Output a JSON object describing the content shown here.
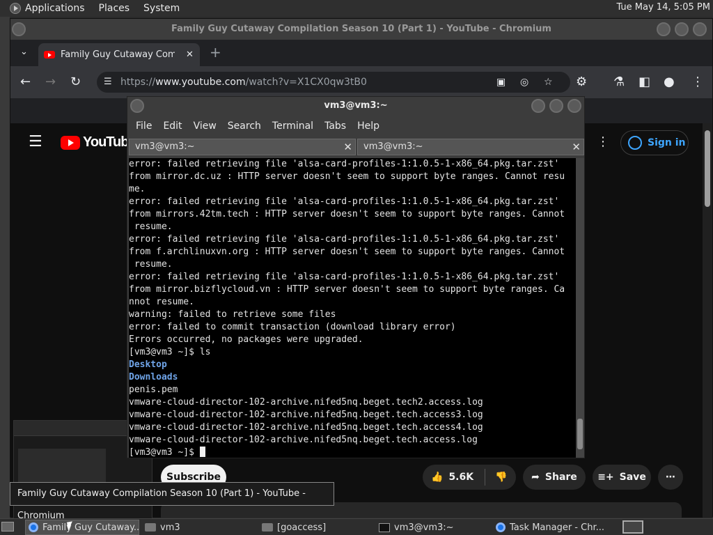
{
  "top_panel": {
    "menus": [
      "Applications",
      "Places",
      "System"
    ],
    "clock": "Tue May 14,  5:05 PM"
  },
  "browser": {
    "window_title": "Family Guy Cutaway Compilation Season 10 (Part 1) - YouTube - Chromium",
    "tab_title": "Family Guy Cutaway Compil",
    "url_prefix": "https://",
    "url_host": "www.youtube.com",
    "url_path": "/watch?v=X1CX0qw3tB0"
  },
  "youtube": {
    "logo_text": "YouTube",
    "sign_in": "Sign in",
    "subscribe": "Subscribe",
    "likes": "5.6K",
    "share": "Share",
    "save": "Save"
  },
  "terminal": {
    "title": "vm3@vm3:~",
    "menu": [
      "File",
      "Edit",
      "View",
      "Search",
      "Terminal",
      "Tabs",
      "Help"
    ],
    "tabs": [
      "vm3@vm3:~",
      "vm3@vm3:~"
    ],
    "lines": [
      "error: failed retrieving file 'alsa-card-profiles-1:1.0.5-1-x86_64.pkg.tar.zst'",
      "from mirror.dc.uz : HTTP server doesn't seem to support byte ranges. Cannot resu",
      "me.",
      "error: failed retrieving file 'alsa-card-profiles-1:1.0.5-1-x86_64.pkg.tar.zst'",
      "from mirrors.42tm.tech : HTTP server doesn't seem to support byte ranges. Cannot",
      " resume.",
      "error: failed retrieving file 'alsa-card-profiles-1:1.0.5-1-x86_64.pkg.tar.zst'",
      "from f.archlinuxvn.org : HTTP server doesn't seem to support byte ranges. Cannot",
      " resume.",
      "error: failed retrieving file 'alsa-card-profiles-1:1.0.5-1-x86_64.pkg.tar.zst'",
      "from mirror.bizflycloud.vn : HTTP server doesn't seem to support byte ranges. Ca",
      "nnot resume.",
      "warning: failed to retrieve some files",
      "error: failed to commit transaction (download library error)",
      "Errors occurred, no packages were upgraded.",
      "[vm3@vm3 ~]$ ls"
    ],
    "ls_dirs": [
      "Desktop",
      "Downloads"
    ],
    "ls_files": [
      "penis.pem",
      "vmware-cloud-director-102-archive.nifed5nq.beget.tech2.access.log",
      "vmware-cloud-director-102-archive.nifed5nq.beget.tech.access3.log",
      "vmware-cloud-director-102-archive.nifed5nq.beget.tech.access4.log",
      "vmware-cloud-director-102-archive.nifed5nq.beget.tech.access.log"
    ],
    "prompt": "[vm3@vm3 ~]$ "
  },
  "tooltip": "Family Guy Cutaway Compilation Season 10 (Part 1) - YouTube - Chromium",
  "taskbar": {
    "items": [
      {
        "label": "Family Guy Cutaway..."
      },
      {
        "label": "vm3"
      },
      {
        "label": "[goaccess]"
      },
      {
        "label": "vm3@vm3:~"
      },
      {
        "label": "Task Manager - Chr..."
      }
    ]
  }
}
